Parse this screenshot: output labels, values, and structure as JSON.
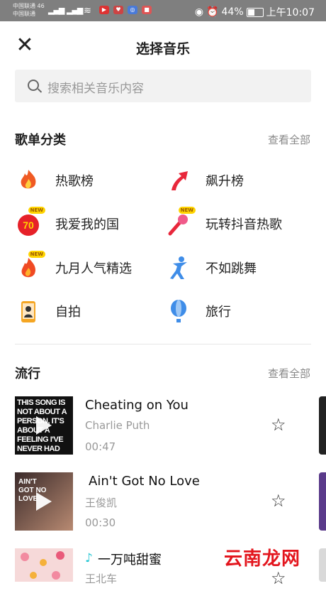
{
  "status_bar": {
    "carrier_1": "中国联通 46",
    "carrier_2": "中国联通",
    "battery": "44%",
    "time": "上午10:07"
  },
  "header": {
    "title": "选择音乐",
    "close_icon": "close-icon"
  },
  "search": {
    "placeholder": "搜索相关音乐内容"
  },
  "playlist_section": {
    "title": "歌单分类",
    "see_all": "查看全部",
    "categories": [
      {
        "label": "热歌榜",
        "icon": "fire-icon"
      },
      {
        "label": "飙升榜",
        "icon": "rising-arrow-icon"
      },
      {
        "label": "我爱我的国",
        "icon": "seventy-badge-icon",
        "badge": "NEW"
      },
      {
        "label": "玩转抖音热歌",
        "icon": "microphone-icon",
        "badge": "NEW"
      },
      {
        "label": "九月人气精选",
        "icon": "flame-icon",
        "badge": "NEW"
      },
      {
        "label": "不如跳舞",
        "icon": "dancer-icon"
      },
      {
        "label": "自拍",
        "icon": "selfie-phone-icon"
      },
      {
        "label": "旅行",
        "icon": "hot-air-balloon-icon"
      }
    ]
  },
  "popular_section": {
    "title": "流行",
    "see_all": "查看全部",
    "tracks": [
      {
        "title": "Cheating on You",
        "artist": "Charlie Puth",
        "duration": "00:47",
        "cover_text": "THIS SONG IS NOT ABOUT A PERSON, IT'S ABOUT A FEELING I'VE NEVER HAD"
      },
      {
        "title": "Ain't Got No Love",
        "artist": "王俊凯",
        "duration": "00:30",
        "cover_text": "AIN'T GOT NO LOVE"
      },
      {
        "title": "一万吨甜蜜",
        "artist": "王北车",
        "duration": ""
      }
    ]
  },
  "watermark": "云南龙网"
}
